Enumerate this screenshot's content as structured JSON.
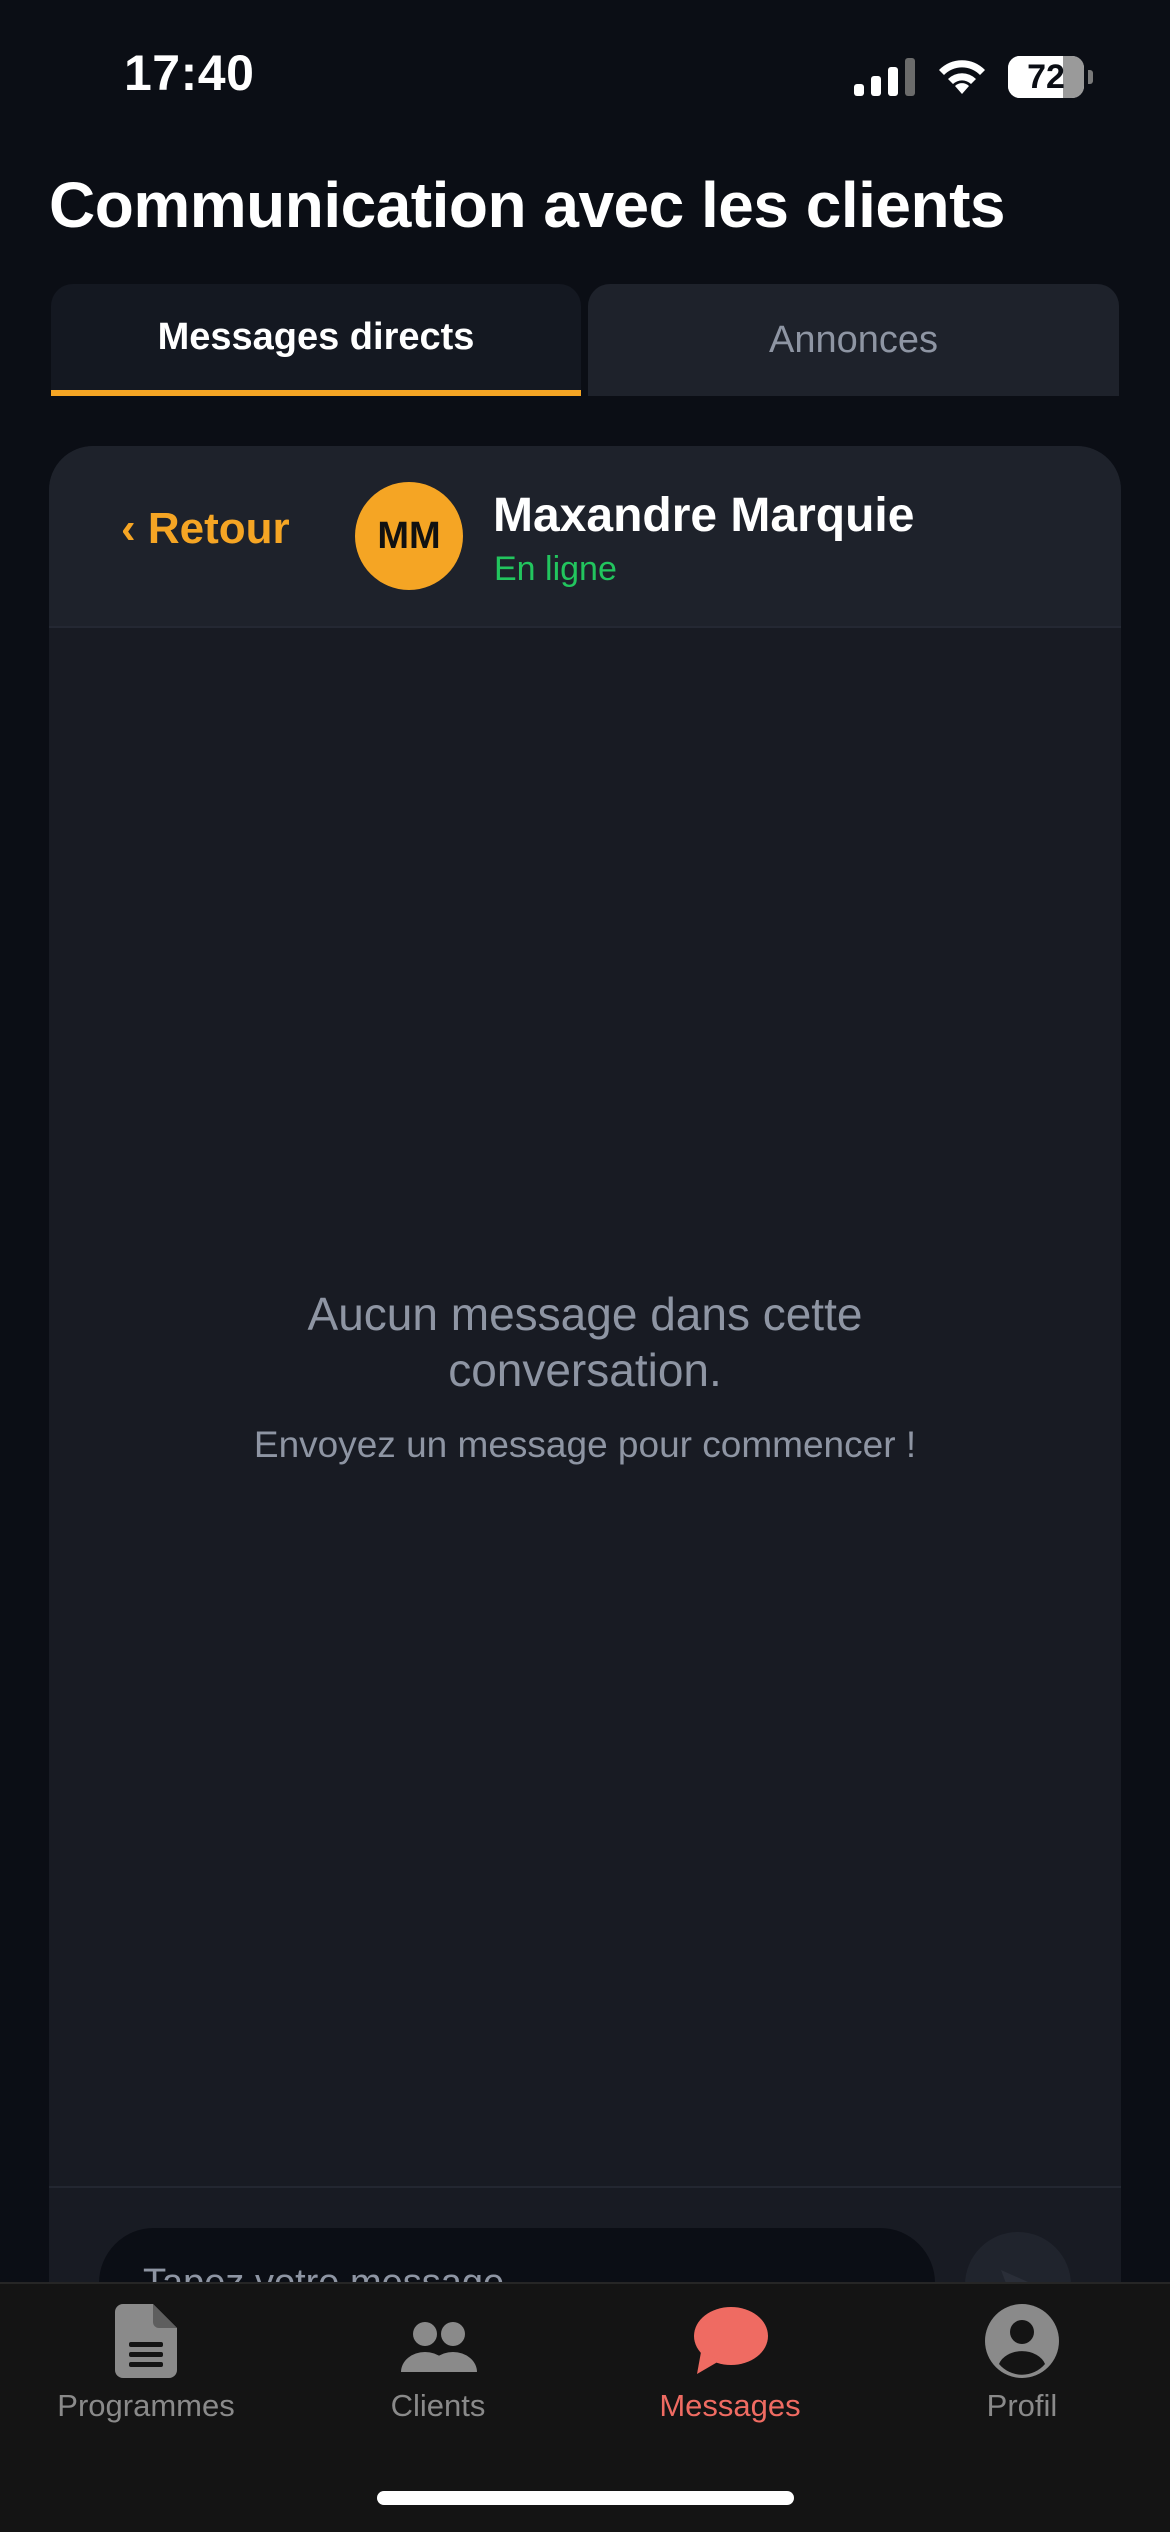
{
  "status_bar": {
    "time": "17:40",
    "battery": "72",
    "battery_level_percent": 72
  },
  "page": {
    "title": "Communication avec les clients"
  },
  "tabs": [
    {
      "label": "Messages directs",
      "active": true
    },
    {
      "label": "Annonces",
      "active": false
    }
  ],
  "conversation": {
    "back_label": "‹ Retour",
    "avatar_initials": "MM",
    "contact_name": "Maxandre Marquie",
    "contact_status": "En ligne",
    "empty_title": "Aucun message dans cette conversation.",
    "empty_subtitle": "Envoyez un message pour commencer !",
    "input_placeholder": "Tapez votre message..."
  },
  "tab_bar": {
    "items": [
      {
        "label": "Programmes",
        "icon": "document-icon",
        "active": false
      },
      {
        "label": "Clients",
        "icon": "people-icon",
        "active": false
      },
      {
        "label": "Messages",
        "icon": "chat-bubble-icon",
        "active": true
      },
      {
        "label": "Profil",
        "icon": "person-circle-icon",
        "active": false
      }
    ]
  },
  "colors": {
    "background": "#0b0e15",
    "card": "#181b23",
    "accent": "#f5a524",
    "online": "#22c55e",
    "active_tab": "#ef6b62",
    "muted_text": "#8e95a3"
  }
}
